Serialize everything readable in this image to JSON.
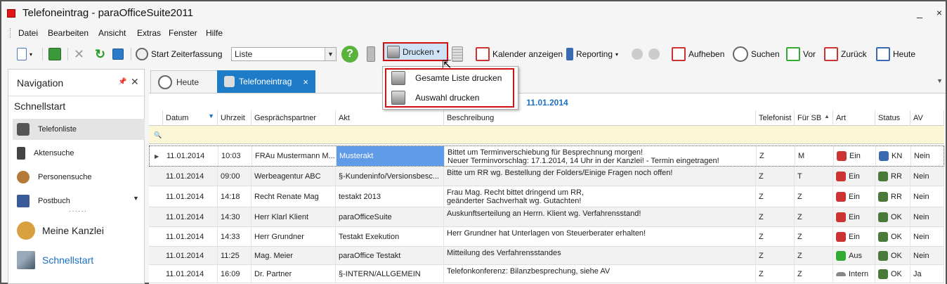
{
  "window": {
    "title": "Telefoneintrag - paraOfficeSuite2011",
    "min_label": "_",
    "close_label": "×"
  },
  "menu": [
    "Datei",
    "Bearbeiten",
    "Ansicht",
    "Extras",
    "Fenster",
    "Hilfe"
  ],
  "toolbar": {
    "start_zeiterfassung": "Start Zeiterfassung",
    "combo_value": "Liste",
    "drucken": "Drucken",
    "kalender": "Kalender anzeigen",
    "reporting": "Reporting",
    "aufheben": "Aufheben",
    "suchen": "Suchen",
    "vor": "Vor",
    "zurueck": "Zurück",
    "heute": "Heute"
  },
  "print_menu": {
    "items": [
      "Gesamte Liste drucken",
      "Auswahl drucken"
    ]
  },
  "navigation": {
    "title": "Navigation",
    "section": "Schnellstart",
    "items": [
      "Telefonliste",
      "Aktensuche",
      "Personensuche",
      "Postbuch"
    ],
    "bottom": [
      "Meine Kanzlei",
      "Schnellstart"
    ]
  },
  "tabs": [
    {
      "label": "Heute"
    },
    {
      "label": "Telefoneintrag",
      "close": "×"
    }
  ],
  "group_date": "11.01.2014",
  "columns": [
    "Datum",
    "Uhrzeit",
    "Gesprächspartner",
    "Akt",
    "Beschreibung",
    "Telefonist",
    "Für SB",
    "Art",
    "Status",
    "AV"
  ],
  "rows": [
    {
      "datum": "11.01.2014",
      "uhrzeit": "10:03",
      "partner": "FRAu Mustermann M...",
      "akt": "Musterakt",
      "beschreibung": "Bittet um Terminverschiebung für Besprechnung morgen!\nNeuer Terminvorschlag: 17.1.2014, 14 Uhr in der Kanzlei! - Termin eingetragen!",
      "telefonist": "Z",
      "sb": "M",
      "art": "Ein",
      "status": "KN",
      "av": "Nein"
    },
    {
      "datum": "11.01.2014",
      "uhrzeit": "09:00",
      "partner": "Werbeagentur ABC",
      "akt": "§-Kundeninfo/Versionsbesc...",
      "beschreibung": "Bitte um RR wg. Bestellung der Folders/Einige Fragen noch offen!",
      "telefonist": "Z",
      "sb": "T",
      "art": "Ein",
      "status": "RR",
      "av": "Nein"
    },
    {
      "datum": "11.01.2014",
      "uhrzeit": "14:18",
      "partner": "Recht Renate Mag",
      "akt": "testakt 2013",
      "beschreibung": "Frau Mag. Recht bittet dringend um RR,\ngeänderter Sachverhalt wg. Gutachten!",
      "telefonist": "Z",
      "sb": "Z",
      "art": "Ein",
      "status": "RR",
      "av": "Nein"
    },
    {
      "datum": "11.01.2014",
      "uhrzeit": "14:30",
      "partner": "Herr Klarl Klient",
      "akt": "paraOfficeSuite",
      "beschreibung": "Auskunftserteilung an Herrn. Klient wg. Verfahrensstand!",
      "telefonist": "Z",
      "sb": "Z",
      "art": "Ein",
      "status": "OK",
      "av": "Nein"
    },
    {
      "datum": "11.01.2014",
      "uhrzeit": "14:33",
      "partner": "Herr Grundner",
      "akt": "Testakt Exekution",
      "beschreibung": "Herr Grundner hat Unterlagen von Steuerberater erhalten!",
      "telefonist": "Z",
      "sb": "Z",
      "art": "Ein",
      "status": "OK",
      "av": "Nein"
    },
    {
      "datum": "11.01.2014",
      "uhrzeit": "11:25",
      "partner": "Mag. Meier",
      "akt": "paraOffice Testakt",
      "beschreibung": "Mitteilung des Verfahrensstandes",
      "telefonist": "Z",
      "sb": "Z",
      "art": "Aus",
      "status": "OK",
      "av": "Nein"
    },
    {
      "datum": "11.01.2014",
      "uhrzeit": "16:09",
      "partner": "Dr. Partner",
      "akt": "§-INTERN/ALLGEMEIN",
      "beschreibung": "Telefonkonferenz: Bilanzbesprechung, siehe AV",
      "telefonist": "Z",
      "sb": "Z",
      "art": "Intern",
      "status": "OK",
      "av": "Ja"
    }
  ]
}
